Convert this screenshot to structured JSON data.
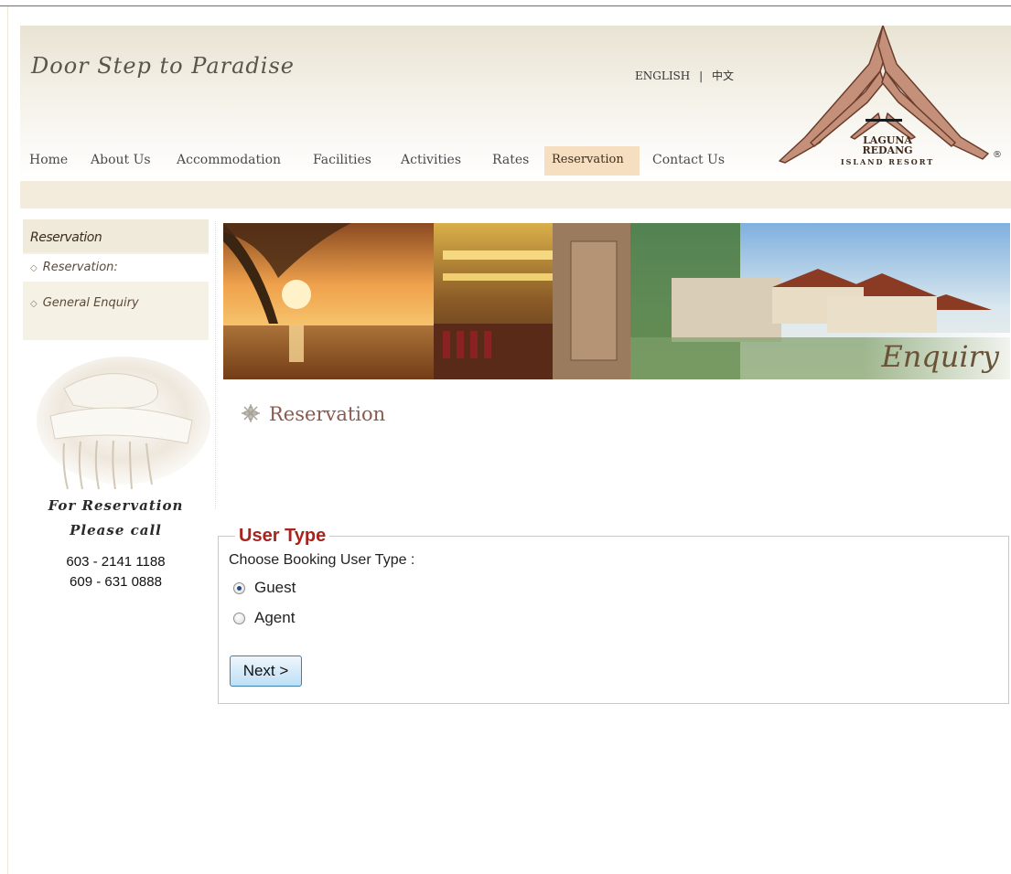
{
  "header": {
    "tagline": "Door Step to Paradise",
    "lang_english": "ENGLISH",
    "lang_separator": "|",
    "lang_chinese": "中文"
  },
  "logo": {
    "line1": "LAGUNA",
    "line2": "REDANG",
    "line3": "ISLAND RESORT",
    "registered_mark": "®"
  },
  "nav": {
    "items": [
      {
        "label": "Home"
      },
      {
        "label": "About Us"
      },
      {
        "label": "Accommodation"
      },
      {
        "label": "Facilities"
      },
      {
        "label": "Activities"
      },
      {
        "label": "Rates"
      },
      {
        "label": "Reservation",
        "active": true
      },
      {
        "label": "Contact Us"
      }
    ]
  },
  "sidebar": {
    "title": "Reservation",
    "items": [
      {
        "label": "Reservation:",
        "selected": true
      },
      {
        "label": "General Enquiry"
      }
    ],
    "call_line1": "For Reservation",
    "call_line2": "Please call",
    "phone1": "603 - 2141 1188",
    "phone2": "609 - 631 0888"
  },
  "banner": {
    "caption": "Enquiry"
  },
  "main": {
    "section_title": "Reservation",
    "fieldset_legend": "User Type",
    "choose_label": "Choose Booking User Type :",
    "options": [
      {
        "label": "Guest",
        "checked": true
      },
      {
        "label": "Agent",
        "checked": false
      }
    ],
    "next_button": "Next >"
  },
  "colors": {
    "legend_red": "#a8241e",
    "nav_active_bg": "#f6dfc1",
    "header_beige": "#e9e3d3",
    "button_border": "#3c7fb1"
  }
}
